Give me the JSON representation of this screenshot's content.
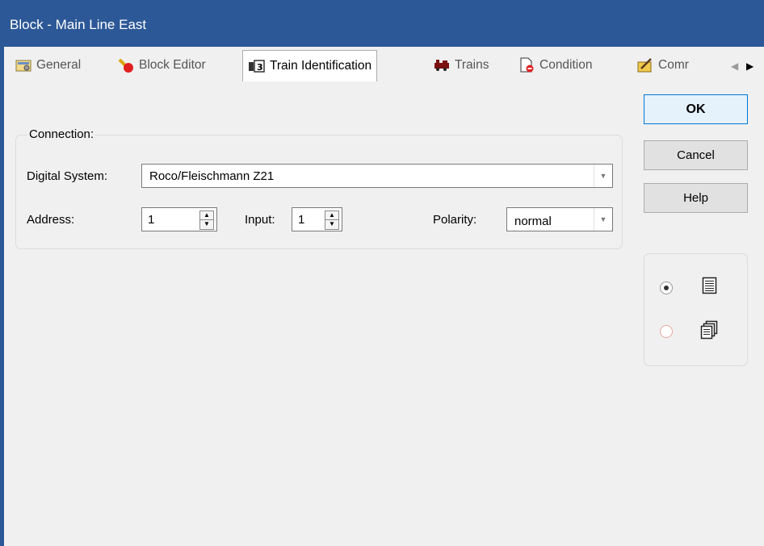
{
  "window": {
    "title": "Block - Main Line East"
  },
  "tabs": [
    {
      "label": "General",
      "icon": "general-settings-icon"
    },
    {
      "label": "Block Editor",
      "icon": "block-editor-icon"
    },
    {
      "label": "Train Identification",
      "icon": "train-identification-icon",
      "active": true
    },
    {
      "label": "Trains",
      "icon": "trains-icon"
    },
    {
      "label": "Condition",
      "icon": "condition-icon"
    },
    {
      "label": "Comr",
      "icon": "commands-icon"
    }
  ],
  "tab_scroll": {
    "left": "◀",
    "right": "▶"
  },
  "connection": {
    "legend": "Connection:",
    "digital_system_label": "Digital System:",
    "digital_system_value": "Roco/Fleischmann Z21",
    "address_label": "Address:",
    "address_value": "1",
    "input_label": "Input:",
    "input_value": "1",
    "polarity_label": "Polarity:",
    "polarity_value": "normal"
  },
  "buttons": {
    "ok": "OK",
    "cancel": "Cancel",
    "help": "Help"
  },
  "view_mode": {
    "options": [
      {
        "icon": "single-page-view-icon",
        "selected": true
      },
      {
        "icon": "multi-page-view-icon",
        "selected": false
      }
    ]
  },
  "colors": {
    "titlebar": "#2c5897",
    "ok_border": "#0078d7"
  }
}
